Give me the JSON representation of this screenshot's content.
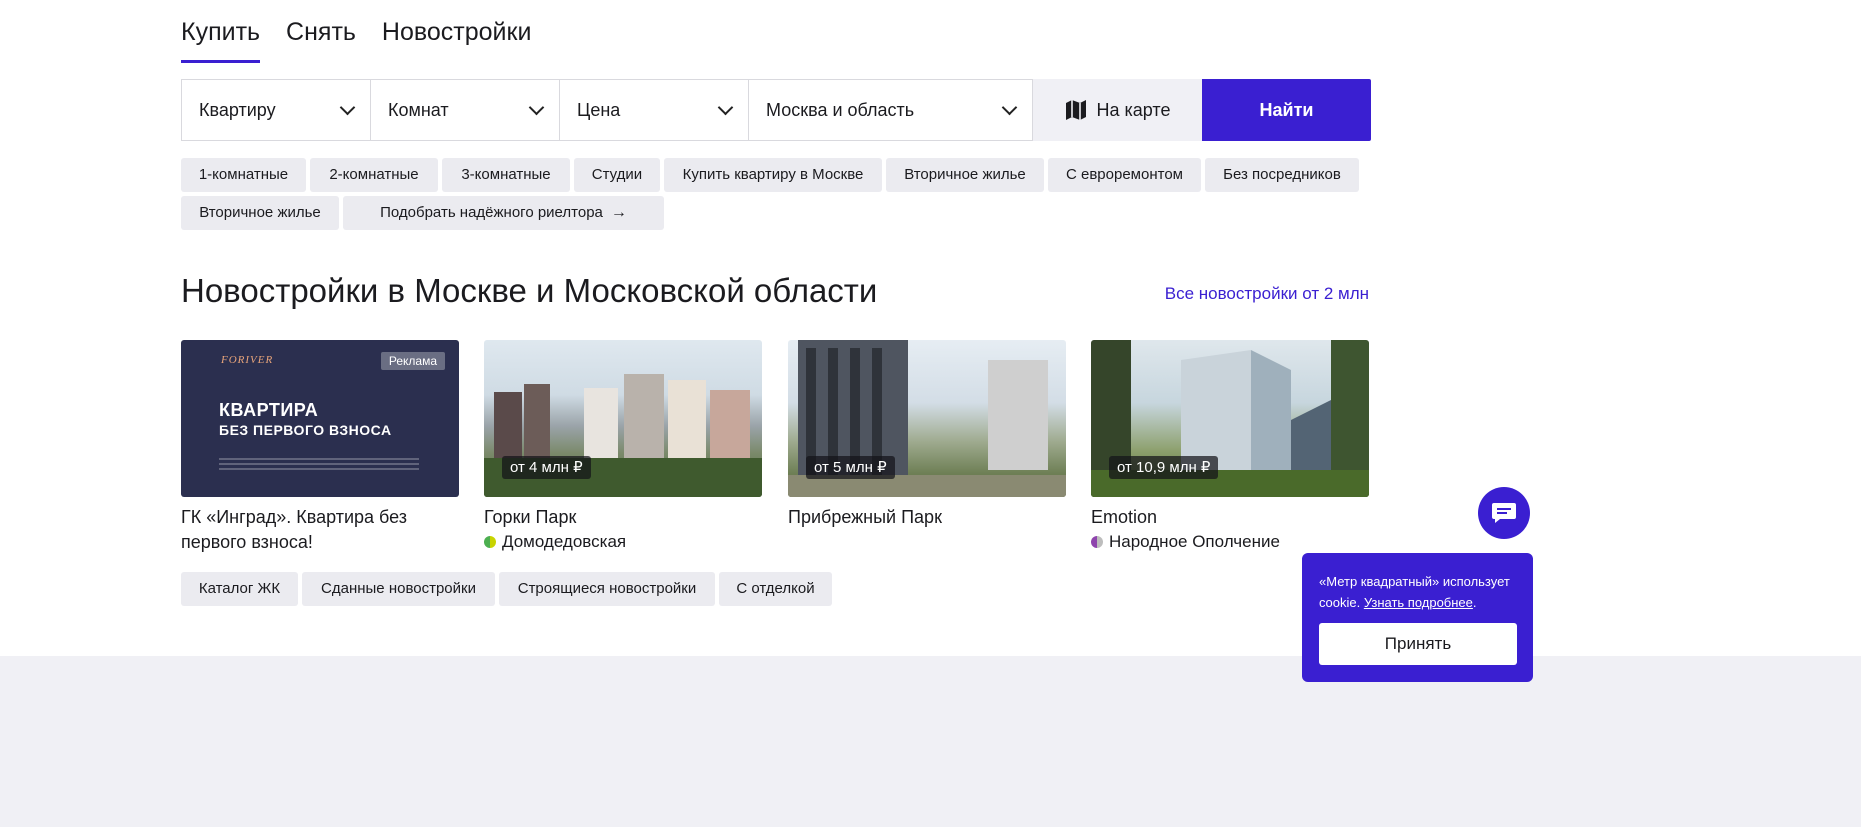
{
  "tabs": [
    {
      "label": "Купить",
      "active": true
    },
    {
      "label": "Снять",
      "active": false
    },
    {
      "label": "Новостройки",
      "active": false
    }
  ],
  "search": {
    "property_type": "Квартиру",
    "rooms": "Комнат",
    "price": "Цена",
    "region": "Москва и область",
    "map_label": "На карте",
    "find_label": "Найти"
  },
  "quick_filters": [
    "1-комнатные",
    "2-комнатные",
    "3-комнатные",
    "Студии",
    "Купить квартиру в Москве",
    "Вторичное жилье",
    "С евроремонтом",
    "Без посредников",
    "Вторичное жилье",
    "Подобрать надёжного риелтора"
  ],
  "new_buildings": {
    "title": "Новостройки в Москве и Московской области",
    "all_link": "Все новостройки от 2 млн",
    "cards": [
      {
        "type": "ad",
        "badge": "Реклама",
        "logo_text": "FORIVER",
        "ad_heading_1": "КВАРТИРА",
        "ad_heading_2": "БЕЗ ПЕРВОГО ВЗНОСА",
        "title": "ГК «Инград». Квартира без первого взноса!"
      },
      {
        "type": "complex",
        "price": "от 4 млн ₽",
        "title": "Горки Парк",
        "metro": "Домодедовская",
        "metro_colors": [
          "#4caf50",
          "#c8d400"
        ]
      },
      {
        "type": "complex",
        "price": "от 5 млн ₽",
        "title": "Прибрежный Парк",
        "metro": ""
      },
      {
        "type": "complex",
        "price": "от 10,9 млн ₽",
        "title": "Emotion",
        "metro": "Народное Ополчение",
        "metro_colors": [
          "#8e44ad",
          "#bdbdbd"
        ]
      }
    ]
  },
  "catalog_chips": [
    "Каталог ЖК",
    "Сданные новостройки",
    "Строящиеся новостройки",
    "С отделкой"
  ],
  "cookie": {
    "text": "«Метр квадратный» использует cookie.",
    "link": "Узнать подробнее",
    "accept": "Принять"
  },
  "colors": {
    "accent": "#3a1fd1",
    "chip_bg": "#ebebf0",
    "ad_bg": "#2b2f4f"
  },
  "icons": {
    "map": "map-icon",
    "chat": "chat-icon",
    "arrow": "arrow-right-icon",
    "chevron": "chevron-down-icon"
  }
}
